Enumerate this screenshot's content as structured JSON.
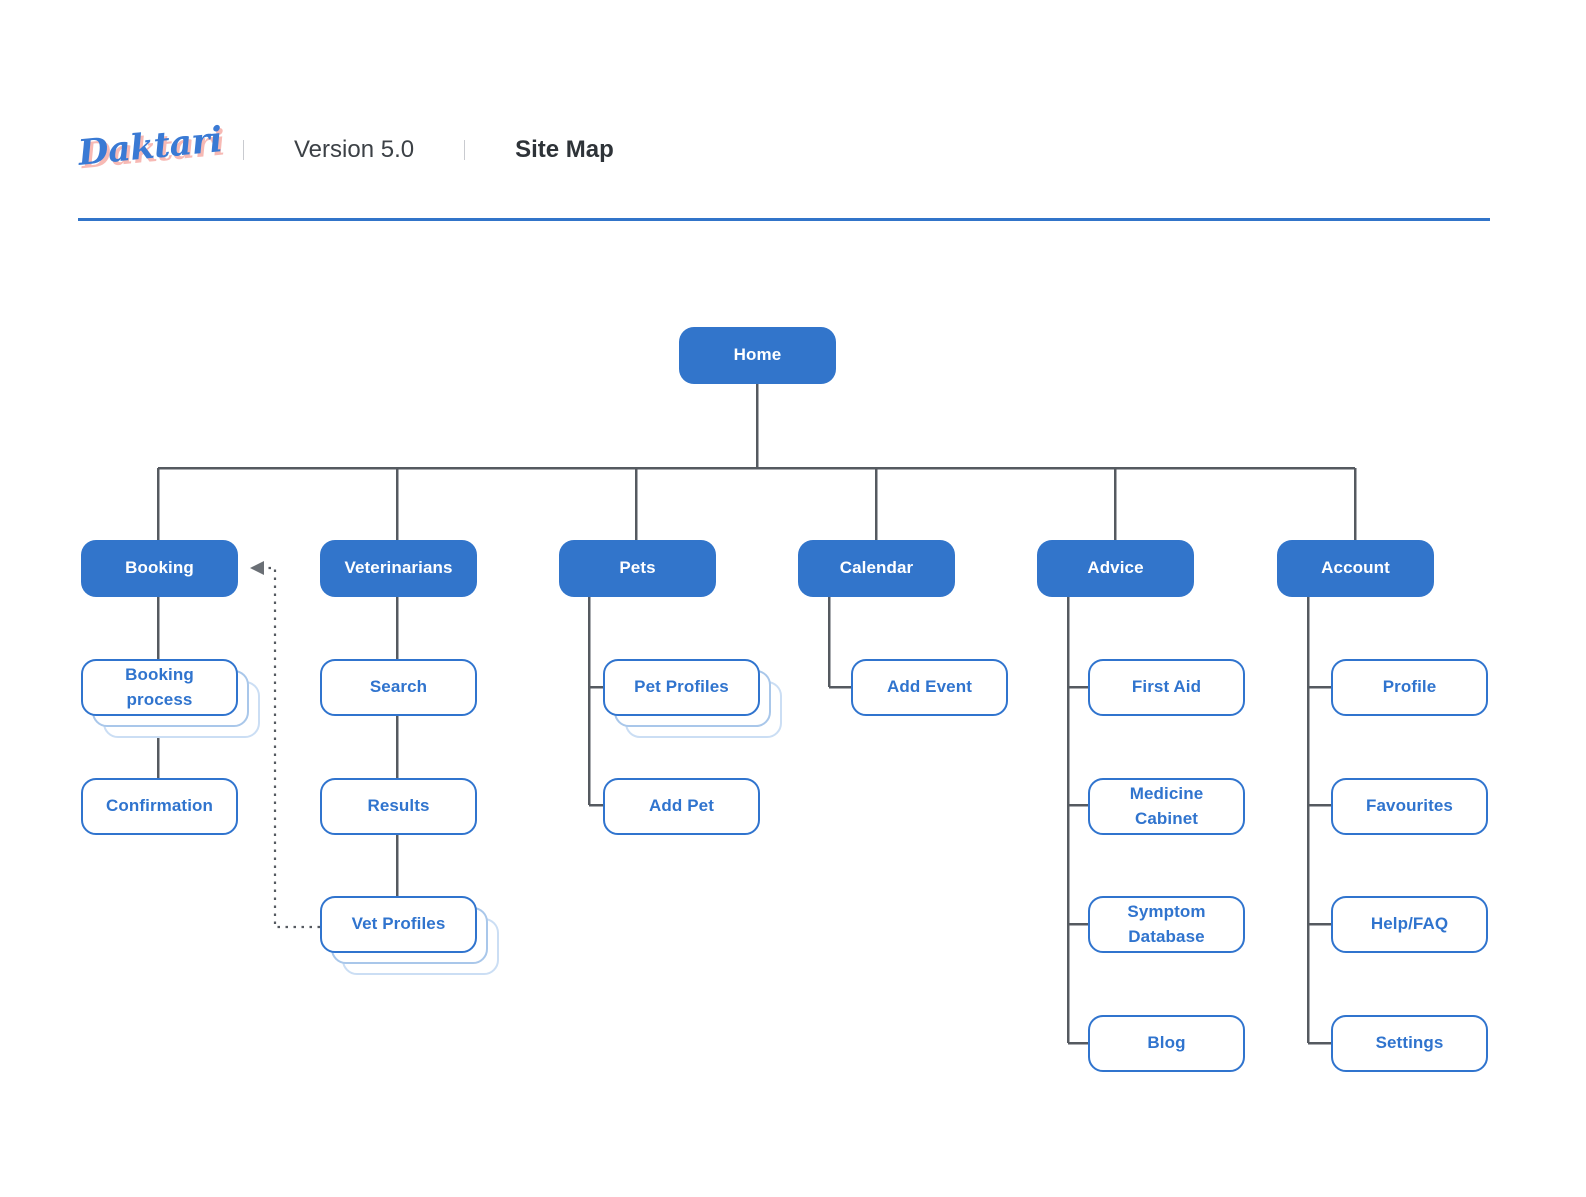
{
  "header": {
    "logo_text": "Daktari",
    "version": "Version 5.0",
    "title": "Site Map"
  },
  "diagram": {
    "root": {
      "label": "Home"
    },
    "branches": [
      {
        "label": "Booking",
        "children": [
          {
            "label": "Booking process",
            "stacked": true
          },
          {
            "label": "Confirmation",
            "stacked": false
          }
        ]
      },
      {
        "label": "Veterinarians",
        "children": [
          {
            "label": "Search",
            "stacked": false
          },
          {
            "label": "Results",
            "stacked": false
          },
          {
            "label": "Vet Profiles",
            "stacked": true
          }
        ]
      },
      {
        "label": "Pets",
        "children": [
          {
            "label": "Pet Profiles",
            "stacked": true
          },
          {
            "label": "Add Pet",
            "stacked": false
          }
        ]
      },
      {
        "label": "Calendar",
        "children": [
          {
            "label": "Add Event",
            "stacked": false
          }
        ]
      },
      {
        "label": "Advice",
        "children": [
          {
            "label": "First Aid",
            "stacked": false
          },
          {
            "label": "Medicine Cabinet",
            "stacked": false
          },
          {
            "label": "Symptom\nDatabase",
            "stacked": false
          },
          {
            "label": "Blog",
            "stacked": false
          }
        ]
      },
      {
        "label": "Account",
        "children": [
          {
            "label": "Profile",
            "stacked": false
          },
          {
            "label": "Favourites",
            "stacked": false
          },
          {
            "label": "Help/FAQ",
            "stacked": false
          },
          {
            "label": "Settings",
            "stacked": false
          }
        ]
      }
    ],
    "cross_link": {
      "from": "Vet Profiles",
      "to": "Booking",
      "style": "dotted"
    }
  },
  "colors": {
    "brand_blue": "#3275cb",
    "node_text_blue": "#3074ce",
    "connector_gray": "#555a60",
    "logo_shadow_pink": "#f7b9b4",
    "stack_mid": "#a9c7ea",
    "stack_light": "#cbdef4"
  }
}
